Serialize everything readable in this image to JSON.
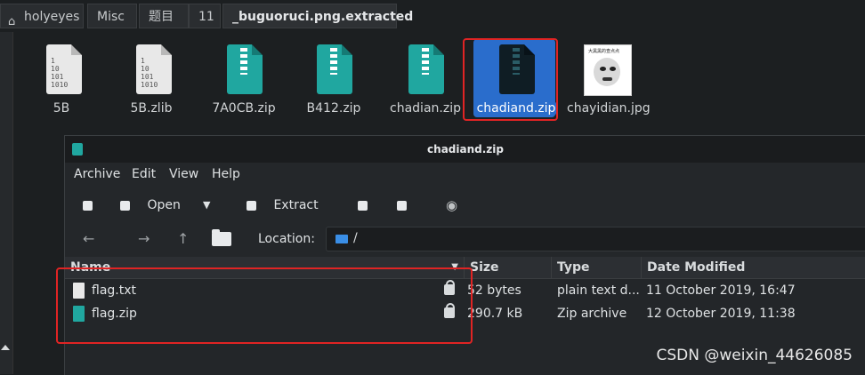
{
  "breadcrumb": {
    "items": [
      {
        "label": "holyeyes"
      },
      {
        "label": "Misc"
      },
      {
        "label": "题目"
      },
      {
        "label": "11"
      },
      {
        "label": "_buguoruci.png.extracted"
      }
    ]
  },
  "files": [
    {
      "name": "5B",
      "icon": "text-file-icon",
      "preview": "1\n10\n101\n1010"
    },
    {
      "name": "5B.zlib",
      "icon": "text-file-icon",
      "preview": "1\n10\n101\n1010"
    },
    {
      "name": "7A0CB.zip",
      "icon": "zip-file-icon"
    },
    {
      "name": "B412.zip",
      "icon": "zip-file-icon"
    },
    {
      "name": "chadian.zip",
      "icon": "zip-file-icon"
    },
    {
      "name": "chadiand.zip",
      "icon": "zip-file-icon",
      "selected": true
    },
    {
      "name": "chayidian.jpg",
      "icon": "image-file-icon",
      "caption": "大黑黑的查点点"
    }
  ],
  "archive_window": {
    "title": "chadiand.zip",
    "menu": [
      "Archive",
      "Edit",
      "View",
      "Help"
    ],
    "toolbar": {
      "open_label": "Open",
      "extract_label": "Extract"
    },
    "location_label": "Location:",
    "location_value": "/",
    "columns": [
      "Name",
      "Size",
      "Type",
      "Date Modified"
    ],
    "rows": [
      {
        "name": "flag.txt",
        "size": "52 bytes",
        "type": "plain text d...",
        "date": "11 October 2019, 16:47",
        "icon": "text-file-icon",
        "locked": true
      },
      {
        "name": "flag.zip",
        "size": "290.7 kB",
        "type": "Zip archive",
        "date": "12 October 2019, 11:38",
        "icon": "zip-file-icon",
        "locked": true
      }
    ]
  },
  "watermark": "CSDN @weixin_44626085",
  "colors": {
    "selection": "#2a6dcc",
    "highlight_box": "#e02424",
    "zip_teal": "#20a7a0"
  }
}
